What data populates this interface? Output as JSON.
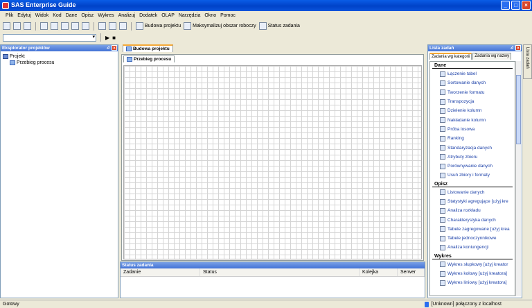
{
  "window": {
    "title": "SAS Enterprise Guide"
  },
  "menu": [
    "Plik",
    "Edytuj",
    "Widok",
    "Kod",
    "Dane",
    "Opisz",
    "Wykres",
    "Analizuj",
    "Dodatek",
    "OLAP",
    "Narzędzia",
    "Okno",
    "Pomoc"
  ],
  "toolbar": {
    "build_project_label": "Budowa projektu",
    "maximize_label": "Maksymalizuj obszar roboczy",
    "task_status_label": "Status zadania"
  },
  "project_explorer": {
    "title": "Eksplorator projektów",
    "root": "Projekt",
    "child": "Przebieg procesu"
  },
  "center": {
    "outer_tab": "Budowa projektu",
    "inner_tab": "Przebieg procesu"
  },
  "task_status": {
    "title": "Status zadania",
    "columns": [
      "Zadanie",
      "Status",
      "Kolejka",
      "Serwer"
    ]
  },
  "task_list": {
    "title": "Lista zadań",
    "tabs": [
      "Zadania wg kategorii",
      "Zadania wg nazwy"
    ],
    "sections": [
      {
        "name": "Dane",
        "items": [
          "Łączenie tabel",
          "Sortowanie danych",
          "Tworzenie formatu",
          "Transpozycja",
          "Dzielenie kolumn",
          "Nakładanie kolumn",
          "Próba losowa",
          "Ranking",
          "Standaryzacja danych",
          "Atrybuty zbioru",
          "Porównywanie danych",
          "Usuń zbiory i formaty"
        ]
      },
      {
        "name": "Opisz",
        "items": [
          "Listowanie danych",
          "Statystyki agregujące [użyj kre",
          "Analiza rozkładu",
          "Charakterystyka danych",
          "Tabele zagregowane [użyj krea",
          "Tabele jednoczynnikowe",
          "Analiza koniungencji"
        ]
      },
      {
        "name": "Wykres",
        "items": [
          "Wykres słupkowy [użyj kreator",
          "Wykres kołowy [użyj kreatora]",
          "Wykres liniowy [użyj kreatora]"
        ]
      }
    ]
  },
  "side_strip": {
    "label": "Lista zadań"
  },
  "statusbar": {
    "left": "Gotowy",
    "connection": "[Unknown] połączony z localhost"
  }
}
